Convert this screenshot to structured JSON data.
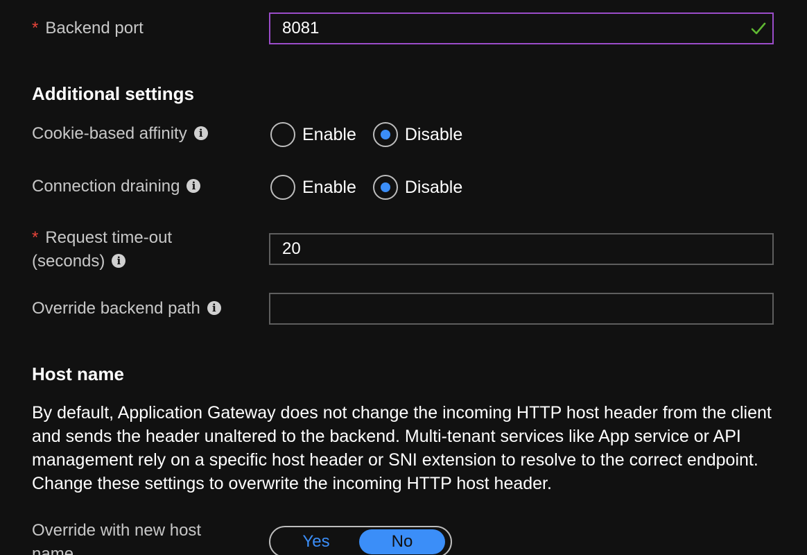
{
  "backend_port": {
    "label": "Backend port",
    "required_marker": "*",
    "value": "8081",
    "valid_icon": "checkmark-icon"
  },
  "additional_settings": {
    "heading": "Additional settings",
    "cookie_affinity": {
      "label": "Cookie-based affinity",
      "info_icon": "info-icon",
      "options": [
        "Enable",
        "Disable"
      ],
      "selected": "Disable"
    },
    "connection_draining": {
      "label": "Connection draining",
      "info_icon": "info-icon",
      "options": [
        "Enable",
        "Disable"
      ],
      "selected": "Disable"
    },
    "request_timeout": {
      "required_marker": "*",
      "label_line1": "Request time-out",
      "label_line2": "(seconds)",
      "value": "20"
    },
    "override_backend_path": {
      "label": "Override backend path",
      "value": ""
    }
  },
  "host_name": {
    "heading": "Host name",
    "description": "By default, Application Gateway does not change the incoming HTTP host header from the client and sends the header unaltered to the backend. Multi-tenant services like App service or API management rely on a specific host header or SNI extension to resolve to the correct endpoint. Change these settings to overwrite the incoming HTTP host header.",
    "override_label_line1": "Override with new host",
    "override_label_line2": "name",
    "toggle": {
      "yes": "Yes",
      "no": "No",
      "selected": "No"
    }
  },
  "colors": {
    "background": "#111111",
    "accent": "#3b8ef8",
    "focus_border": "#9b4dca",
    "valid": "#5fb832",
    "required": "#e8443a"
  }
}
